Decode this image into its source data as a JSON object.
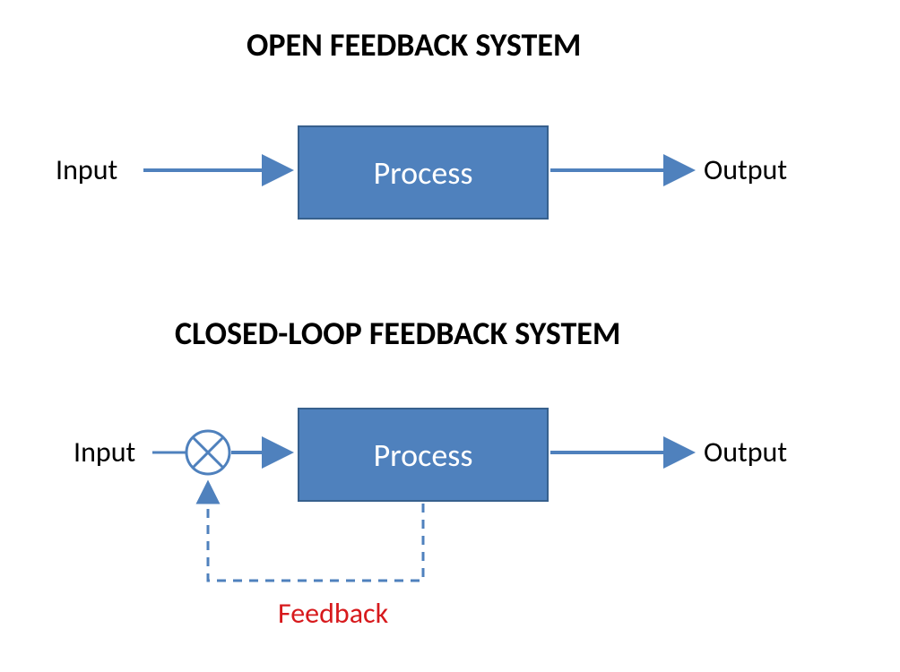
{
  "open": {
    "title": "OPEN FEEDBACK SYSTEM",
    "input": "Input",
    "process": "Process",
    "output": "Output"
  },
  "closed": {
    "title": "CLOSED-LOOP FEEDBACK SYSTEM",
    "input": "Input",
    "process": "Process",
    "output": "Output",
    "feedback": "Feedback"
  },
  "colors": {
    "box_fill": "#4f81bd",
    "box_border": "#37608d",
    "arrow": "#4f81bd",
    "feedback_text": "#d7191c"
  }
}
